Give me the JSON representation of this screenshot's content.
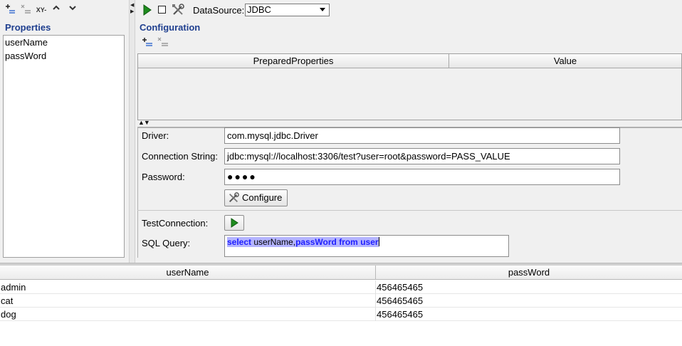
{
  "left_toolbar": {
    "buttons": [
      {
        "name": "add-property-button",
        "icon": "add-list-icon"
      },
      {
        "name": "remove-property-button",
        "icon": "remove-list-icon"
      },
      {
        "name": "xy-button",
        "label": "XY-"
      },
      {
        "name": "move-up-button",
        "icon": "chevron-up-icon"
      },
      {
        "name": "move-down-button",
        "icon": "chevron-down-icon"
      }
    ]
  },
  "properties": {
    "title": "Properties",
    "items": [
      "userName",
      "passWord"
    ]
  },
  "toolbar": {
    "run_icon": "play-icon",
    "stop_icon": "stop-icon",
    "tools_icon": "tools-icon",
    "datasource_label": "DataSource:",
    "datasource_value": "JDBC"
  },
  "configuration": {
    "title": "Configuration",
    "table_headers": [
      "PreparedProperties",
      "Value"
    ],
    "rows": []
  },
  "form": {
    "driver_label": "Driver:",
    "driver_value": "com.mysql.jdbc.Driver",
    "conn_label": "Connection String:",
    "conn_value": "jdbc:mysql://localhost:3306/test?user=root&password=PASS_VALUE",
    "password_label": "Password:",
    "password_value": "●●●●",
    "configure_label": "Configure",
    "test_label": "TestConnection:",
    "sql_label": "SQL Query:",
    "sql": {
      "kw1": "select",
      "p1": " userName,",
      "kw2": "passWord from user"
    }
  },
  "results": {
    "headers": [
      "userName",
      "passWord"
    ],
    "rows": [
      [
        "admin",
        "456465465"
      ],
      [
        "cat",
        "456465465"
      ],
      [
        "dog",
        "456465465"
      ]
    ]
  },
  "colors": {
    "title": "#1f3f8f",
    "run_green": "#1e8c1e",
    "selection": "#b4b4ff"
  }
}
